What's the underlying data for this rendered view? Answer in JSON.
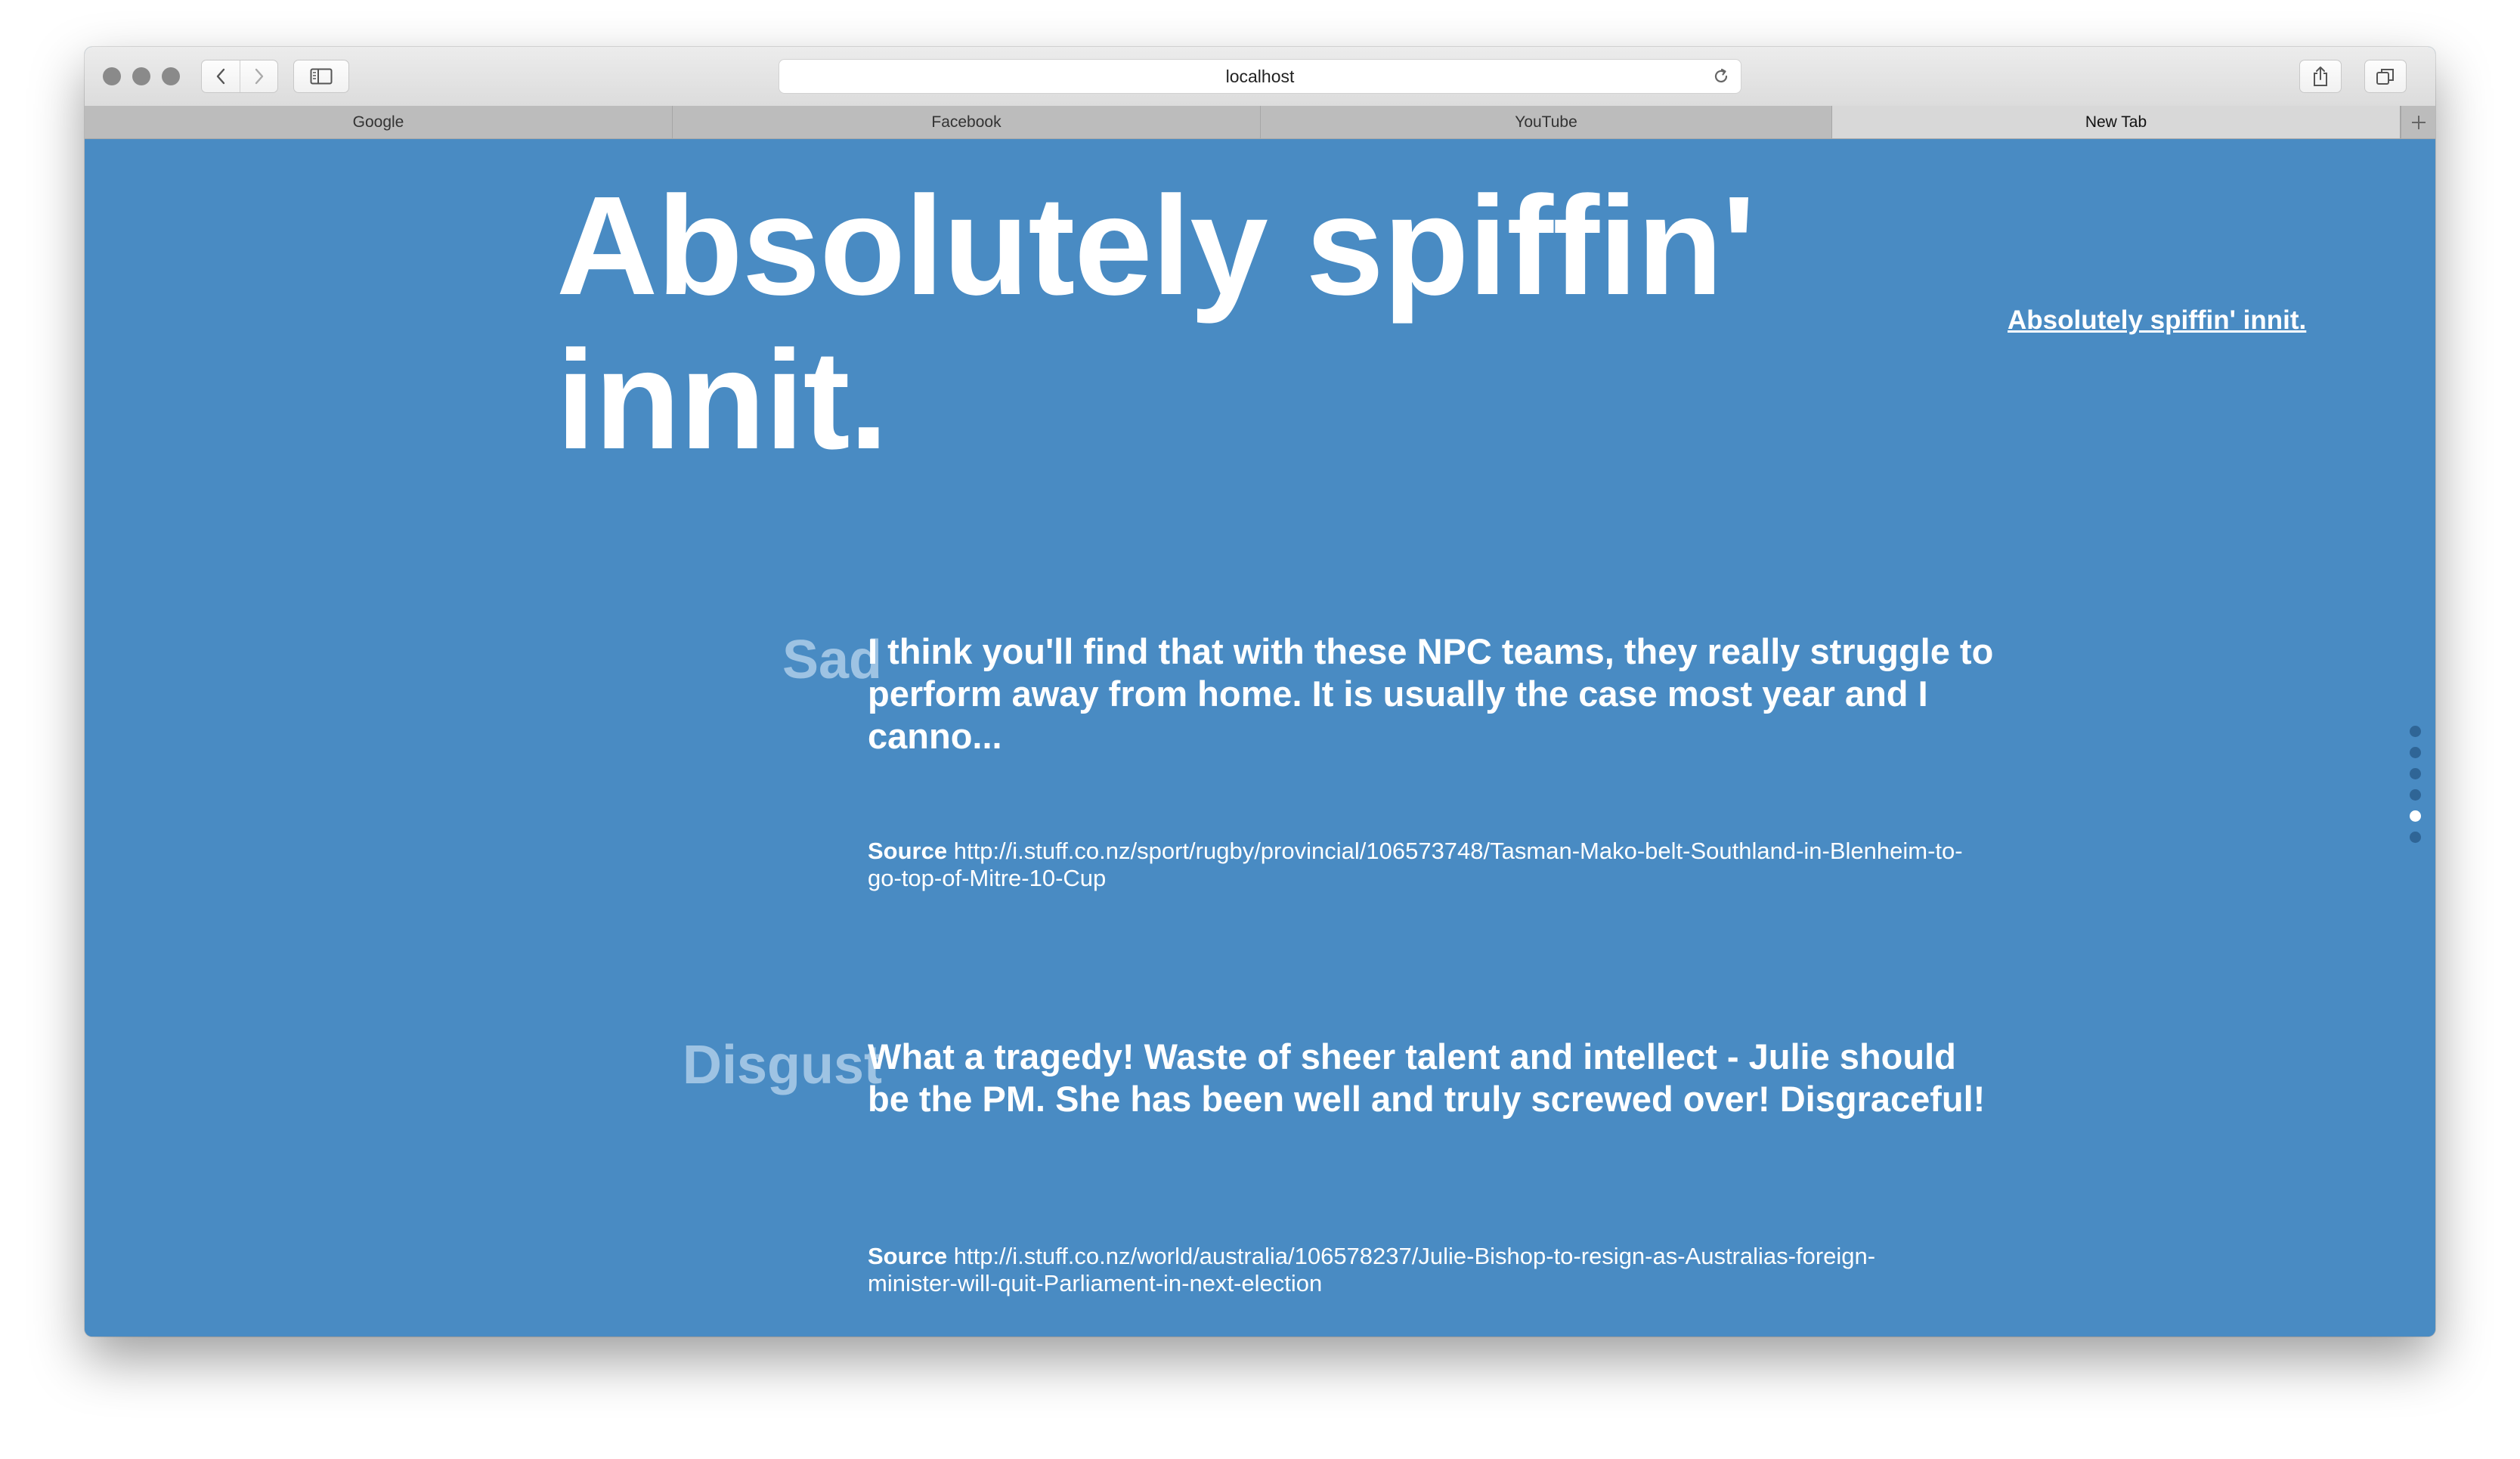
{
  "browser": {
    "url": "localhost",
    "tabs": [
      {
        "label": "Google"
      },
      {
        "label": "Facebook"
      },
      {
        "label": "YouTube"
      },
      {
        "label": "New Tab",
        "active": true
      }
    ]
  },
  "page": {
    "title": "Absolutely spiffin' innit.",
    "header_link": "Absolutely spiffin' innit.",
    "entries": [
      {
        "emotion": "Sad",
        "text": "I think you'll find that with these NPC teams, they really struggle to perform away from home.  It is usually the case most year and I canno...",
        "source_label": "Source",
        "source_url": "http://i.stuff.co.nz/sport/rugby/provincial/106573748/Tasman-Mako-belt-Southland-in-Blenheim-to-go-top-of-Mitre-10-Cup"
      },
      {
        "emotion": "Disgust",
        "text": "What a tragedy!  Waste of sheer talent and intellect - Julie should be the PM.  She has been well and truly screwed over! Disgraceful!",
        "source_label": "Source",
        "source_url": "http://i.stuff.co.nz/world/australia/106578237/Julie-Bishop-to-resign-as-Australias-foreign-minister-will-quit-Parliament-in-next-election"
      }
    ],
    "dot_nav": {
      "count": 6,
      "active_index": 4
    }
  },
  "colors": {
    "page_background": "#498bc3",
    "emotion_label": "#9ec3e3",
    "text": "#ffffff"
  }
}
